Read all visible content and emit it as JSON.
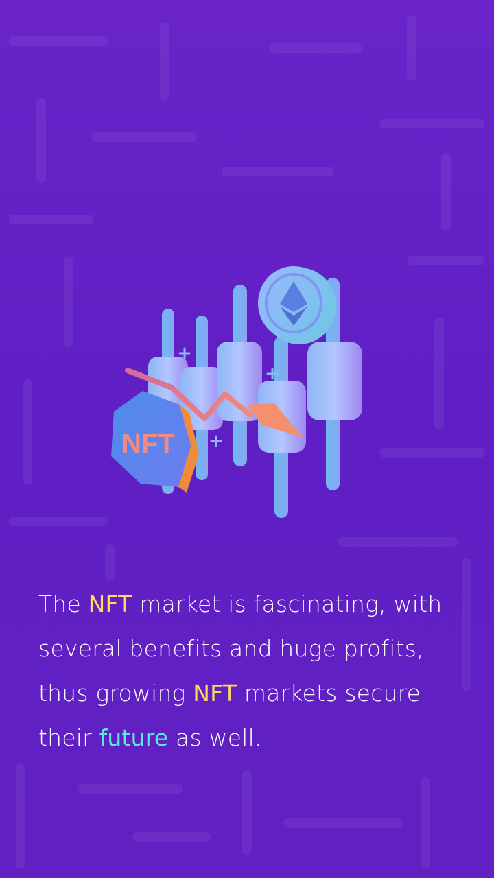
{
  "colors": {
    "background": "#6a24c9",
    "highlight_nft": "#ffd95a",
    "highlight_future": "#5ce8e0",
    "text": "#ffffff"
  },
  "illustration": {
    "badge_text": "NFT",
    "coin_icon": "ethereum-icon"
  },
  "message": {
    "p1": "The ",
    "h1": "NFT",
    "p2": " market is fascinating, with several benefits and huge profits, thus growing ",
    "h2": "NFT",
    "p3": " markets secure their ",
    "h3": "future",
    "p4": " as well."
  }
}
